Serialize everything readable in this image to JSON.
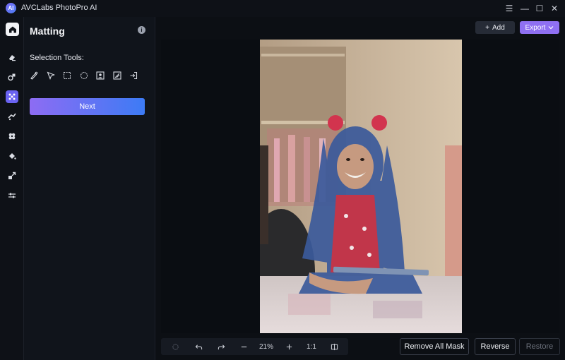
{
  "app": {
    "title": "AVCLabs PhotoPro AI",
    "logo_text": "AI"
  },
  "window_controls": {
    "menu": "☰",
    "minimize": "—",
    "maximize": "☐",
    "close": "✕"
  },
  "rail": {
    "items": [
      "home-icon",
      "eraser-icon",
      "replace-icon",
      "matting-icon",
      "enhance-icon",
      "colorize-icon",
      "fill-icon",
      "upscale-icon",
      "adjust-icon"
    ],
    "active": "matting-icon"
  },
  "panel": {
    "title": "Matting",
    "selection_label": "Selection Tools:",
    "tools": [
      "brush-icon",
      "pointer-icon",
      "rectangle-select-icon",
      "ellipse-select-icon",
      "portrait-select-icon",
      "object-select-icon",
      "export-selection-icon"
    ],
    "next_label": "Next"
  },
  "header": {
    "add_label": "Add",
    "add_icon": "+",
    "export_label": "Export"
  },
  "toolbar": {
    "zoom": "21%",
    "ratio": "1:1"
  },
  "actions": {
    "remove_all_mask": "Remove All Mask",
    "reverse": "Reverse",
    "restore": "Restore"
  },
  "colors": {
    "accent": "#6a63f2",
    "export": "#8f70f2",
    "mask_overlay": "#3b5a9b"
  }
}
